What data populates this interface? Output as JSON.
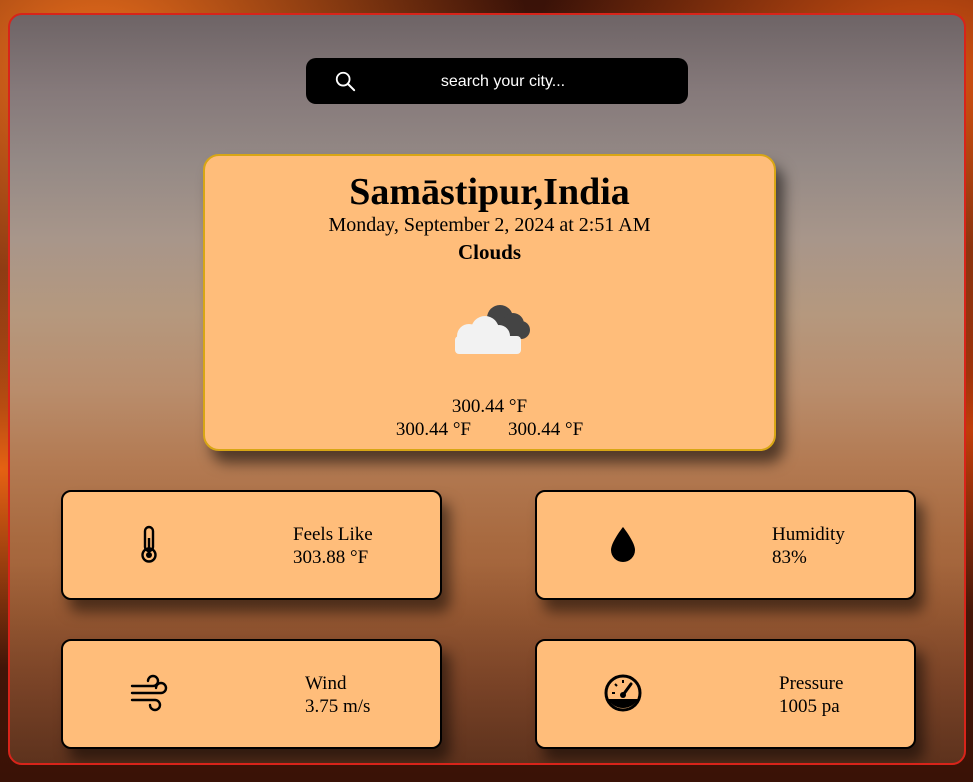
{
  "search": {
    "placeholder": "search your city...",
    "icon": "search-icon"
  },
  "weather": {
    "city": "Samāstipur,India",
    "datetime": "Monday, September 2, 2024 at 2:51 AM",
    "condition": "Clouds",
    "icon": "cloud-icon",
    "temperature": "300.44 °F",
    "min_temp": "300.44 °F",
    "max_temp": "300.44 °F"
  },
  "details": {
    "feels_like": {
      "label": "Feels Like",
      "value": "303.88 °F",
      "icon": "thermometer-icon"
    },
    "humidity": {
      "label": "Humidity",
      "value": "83%",
      "icon": "droplet-icon"
    },
    "wind": {
      "label": "Wind",
      "value": "3.75 m/s",
      "icon": "wind-icon"
    },
    "pressure": {
      "label": "Pressure",
      "value": "1005 pa",
      "icon": "gauge-icon"
    }
  },
  "colors": {
    "card": "#ffbd7a",
    "card_border": "#d8a615",
    "frame_border": "#d8241a",
    "search_bg": "#000000"
  }
}
